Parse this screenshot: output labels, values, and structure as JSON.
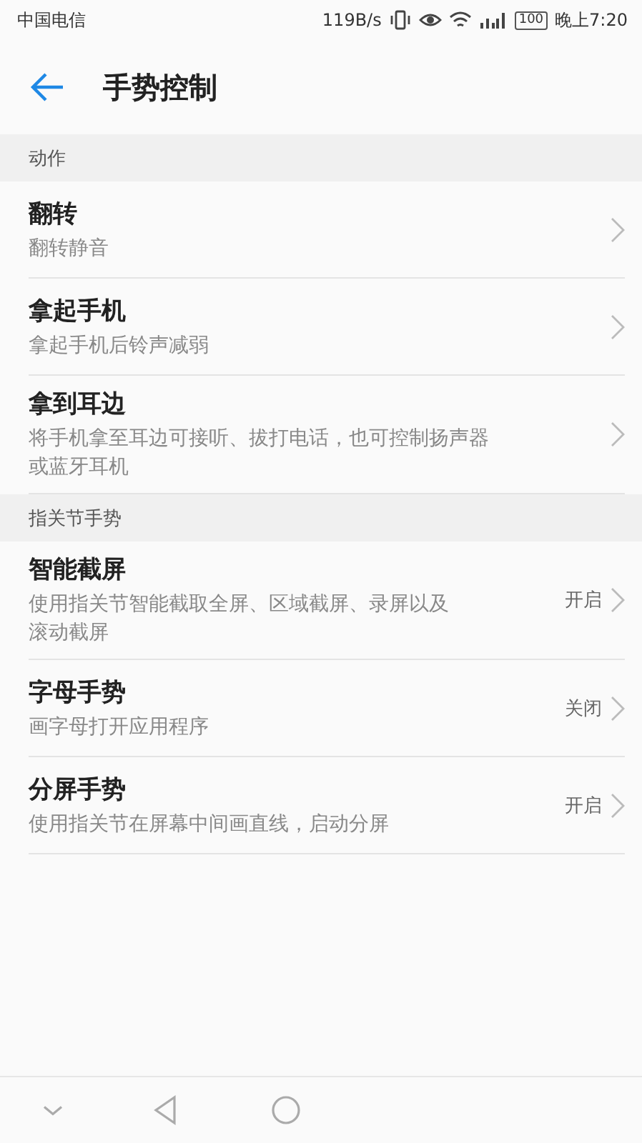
{
  "status_bar": {
    "carrier": "中国电信",
    "speed": "119B/s",
    "battery": "100",
    "time": "晚上7:20"
  },
  "header": {
    "title": "手势控制"
  },
  "sections": [
    {
      "title": "动作",
      "items": [
        {
          "title": "翻转",
          "subtitle": "翻转静音"
        },
        {
          "title": "拿起手机",
          "subtitle": "拿起手机后铃声减弱"
        },
        {
          "title": "拿到耳边",
          "subtitle": "将手机拿至耳边可接听、拔打电话，也可控制扬声器或蓝牙耳机"
        }
      ]
    },
    {
      "title": "指关节手势",
      "items": [
        {
          "title": "智能截屏",
          "subtitle": "使用指关节智能截取全屏、区域截屏、录屏以及滚动截屏",
          "value": "开启"
        },
        {
          "title": "字母手势",
          "subtitle": "画字母打开应用程序",
          "value": "关闭"
        },
        {
          "title": "分屏手势",
          "subtitle": "使用指关节在屏幕中间画直线，启动分屏",
          "value": "开启"
        }
      ]
    }
  ]
}
